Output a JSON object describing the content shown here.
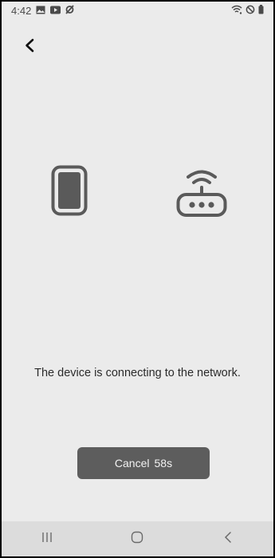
{
  "status_bar": {
    "time": "4:42",
    "icons_left": [
      "image-icon",
      "youtube-icon",
      "sync-off-icon"
    ],
    "icons_right": [
      "wifi-icon",
      "do-not-disturb-icon",
      "battery-icon"
    ]
  },
  "header": {
    "back_icon": "chevron-left-icon"
  },
  "illustration": {
    "left_icon": "phone-icon",
    "right_icon": "router-wifi-icon"
  },
  "main": {
    "message": "The device is connecting to the network.",
    "cancel_label": "Cancel",
    "countdown": "58s"
  },
  "nav_bar": {
    "buttons": [
      "recents-icon",
      "home-icon",
      "back-icon"
    ]
  },
  "colors": {
    "background": "#ebebeb",
    "button": "#5d5d5d",
    "icon": "#5a5a5a",
    "navbar": "#dcdcdc"
  }
}
